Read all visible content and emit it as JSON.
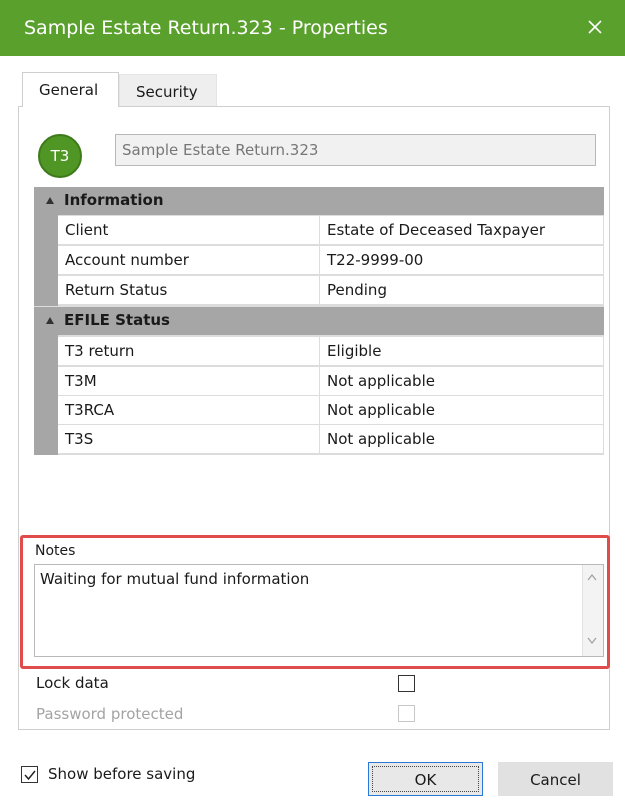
{
  "window": {
    "title": "Sample Estate Return.323 - Properties",
    "close_icon": "close-icon"
  },
  "tabs": [
    {
      "label": "General",
      "active": true
    },
    {
      "label": "Security",
      "active": false
    }
  ],
  "header": {
    "badge_text": "T3",
    "badge_color": "#4f9624",
    "name_value": "Sample Estate Return.323"
  },
  "sections": {
    "information": {
      "title": "Information",
      "rows": [
        {
          "key": "Client",
          "value": "Estate of Deceased Taxpayer"
        },
        {
          "key": "Account number",
          "value": "T22-9999-00"
        },
        {
          "key": "Return Status",
          "value": "Pending"
        }
      ]
    },
    "efile": {
      "title": "EFILE Status",
      "rows": [
        {
          "key": "T3 return",
          "value": "Eligible"
        },
        {
          "key": "T3M",
          "value": "Not applicable"
        },
        {
          "key": "T3RCA",
          "value": "Not applicable"
        },
        {
          "key": "T3S",
          "value": "Not applicable"
        }
      ]
    }
  },
  "notes": {
    "label": "Notes",
    "value": "Waiting for mutual fund information"
  },
  "options": {
    "lock_data": {
      "label": "Lock data",
      "checked": false
    },
    "password_protected": {
      "label": "Password protected",
      "checked": false,
      "disabled": true
    }
  },
  "footer": {
    "show_before_saving": {
      "label": "Show before saving",
      "checked": true
    },
    "ok_label": "OK",
    "cancel_label": "Cancel"
  },
  "colors": {
    "title_bar": "#5aa02c",
    "highlight": "#e04b4b",
    "section_header": "#a6a6a6"
  }
}
